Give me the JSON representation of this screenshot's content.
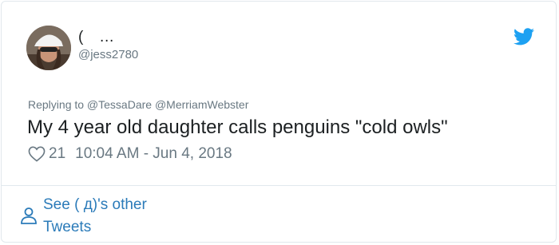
{
  "tweet": {
    "display_name": "(   …",
    "handle": "@jess2780",
    "replying_to": "Replying to @TessaDare @MerriamWebster",
    "text": "My 4 year old daughter calls penguins \"cold owls\"",
    "likes": "21",
    "timestamp": "10:04 AM - Jun 4, 2018"
  },
  "footer": {
    "see_other_line1": "See ( д)'s other",
    "see_other_line2": "Tweets"
  },
  "icons": {
    "brand": "twitter-bird-icon",
    "like": "heart-icon",
    "profile": "person-icon"
  },
  "colors": {
    "brand": "#1da1f2",
    "link": "#2b7bb9",
    "muted": "#697882",
    "text": "#1c2022"
  }
}
